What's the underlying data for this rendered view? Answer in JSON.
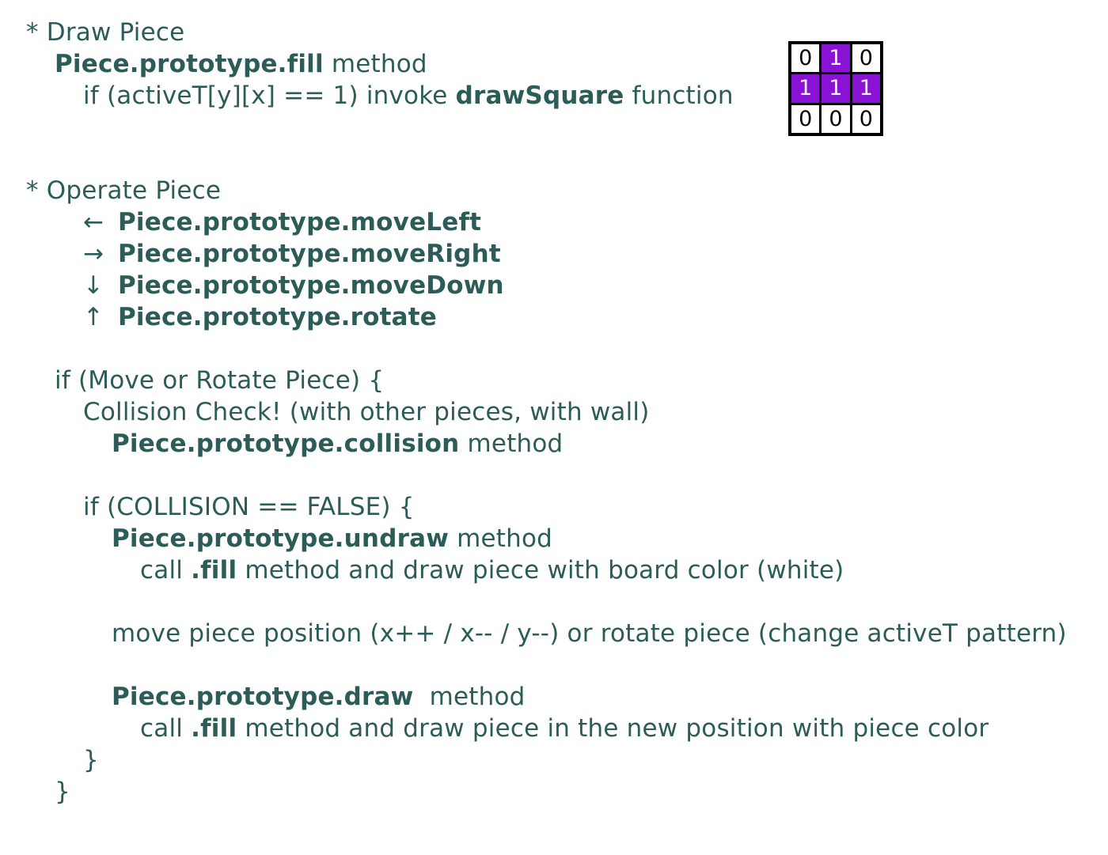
{
  "draw_section": {
    "heading": "* Draw Piece",
    "fill_method_name": "Piece.prototype.fill",
    "fill_method_suffix": " method",
    "condition_prefix": "if (activeT[y][x] == 1) invoke ",
    "condition_function": "drawSquare",
    "condition_suffix": " function"
  },
  "piece_grid": {
    "rows": [
      [
        "0",
        "1",
        "0"
      ],
      [
        "1",
        "1",
        "1"
      ],
      [
        "0",
        "0",
        "0"
      ]
    ],
    "active_color": "#8a12d4",
    "inactive_color": "#ffffff"
  },
  "operate_section": {
    "heading": "* Operate Piece",
    "moves": [
      {
        "arrow": "←",
        "method": "Piece.prototype.moveLeft"
      },
      {
        "arrow": "→",
        "method": "Piece.prototype.moveRight"
      },
      {
        "arrow": "↓",
        "method": "Piece.prototype.moveDown"
      },
      {
        "arrow": "↑",
        "method": "Piece.prototype.rotate"
      }
    ]
  },
  "logic": {
    "if_move": "if (Move or Rotate Piece) {",
    "collision_check": "Collision Check! (with other pieces, with wall)",
    "collision_method": "Piece.prototype.collision",
    "collision_suffix": " method",
    "if_no_collision": "if (COLLISION == FALSE) {",
    "undraw_method": "Piece.prototype.undraw",
    "undraw_suffix": " method",
    "undraw_call_prefix": "call ",
    "undraw_call_fill": ".fill",
    "undraw_call_suffix": " method and draw piece with board color (white)",
    "move_position": "move piece position (x++ / x-- / y--) or rotate piece (change activeT pattern)",
    "draw_method": "Piece.prototype.draw",
    "draw_suffix": "  method",
    "draw_call_prefix": "call ",
    "draw_call_fill": ".fill",
    "draw_call_suffix": " method and draw piece in the new position with piece color",
    "inner_close": "}",
    "outer_close": "}"
  },
  "colors": {
    "text": "#2c5c57",
    "grid_border": "#000000"
  }
}
